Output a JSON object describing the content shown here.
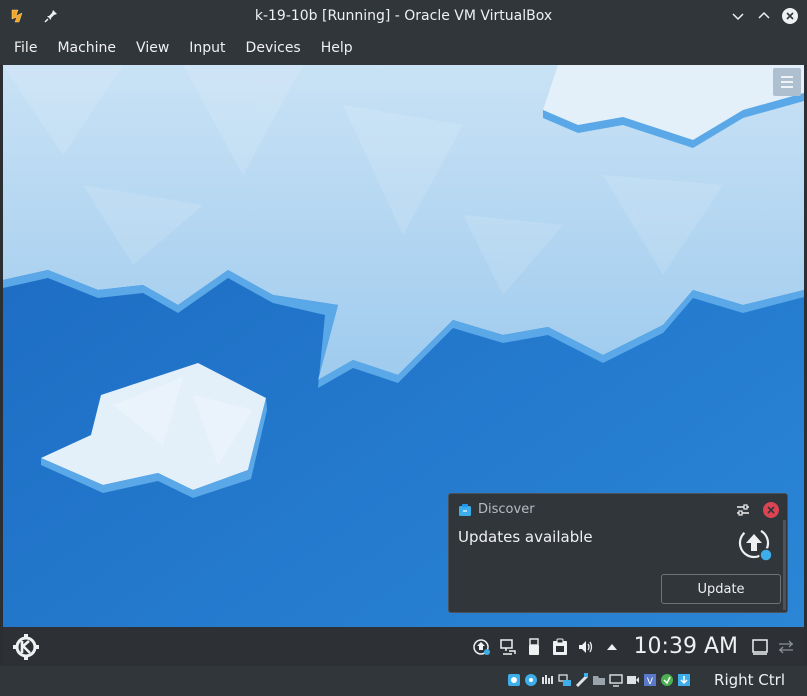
{
  "window": {
    "title": "k-19-10b [Running] - Oracle VM VirtualBox"
  },
  "menubar": {
    "items": [
      {
        "label": "File"
      },
      {
        "label": "Machine"
      },
      {
        "label": "View"
      },
      {
        "label": "Input"
      },
      {
        "label": "Devices"
      },
      {
        "label": "Help"
      }
    ]
  },
  "notification": {
    "app_name": "Discover",
    "message": "Updates available",
    "action_label": "Update",
    "app_icon": "discover-icon",
    "status_icon": "update-arrow-icon"
  },
  "panel": {
    "clock": "10:39 AM",
    "tray_icons": [
      "updates-icon",
      "network-icon",
      "usb-icon",
      "clipboard-icon",
      "volume-icon",
      "tray-expand-icon"
    ]
  },
  "statusbar": {
    "host_key": "Right Ctrl",
    "icons": [
      "hard-disk-icon",
      "optical-drive-icon",
      "audio-icon",
      "network-adapter-icon",
      "usb-devices-icon",
      "shared-folders-icon",
      "display-icon",
      "recording-icon",
      "cpu-icon",
      "mouse-integration-icon",
      "keyboard-icon"
    ]
  },
  "colors": {
    "window_bg": "#31363b",
    "desktop_blue": "#1d6fc4",
    "close_red": "#da4453",
    "accent_blue": "#3daee9"
  }
}
